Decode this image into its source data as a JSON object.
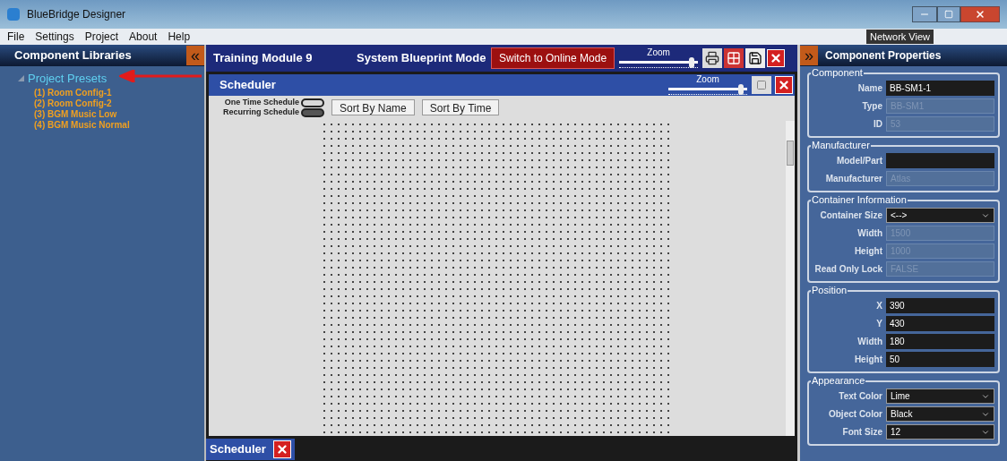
{
  "window": {
    "title": "BlueBridge Designer"
  },
  "menu": [
    "File",
    "Settings",
    "Project",
    "About",
    "Help"
  ],
  "network_view": "Network View",
  "left_panel": {
    "title": "Component Libraries",
    "collapse": "«",
    "tree": [
      {
        "label": "Project Presets",
        "expanded": true,
        "children": [
          {
            "label": "(1) Room Config-1"
          },
          {
            "label": "(2) Room Config-2"
          },
          {
            "label": "(3) BGM Music Low"
          },
          {
            "label": "(4) BGM Music Normal"
          }
        ]
      }
    ]
  },
  "workspace": {
    "title": "Training Module 9",
    "mode": "System Blueprint Mode",
    "online_button": "Switch to Online Mode",
    "zoom": {
      "label": "Zoom",
      "level": 0.95
    }
  },
  "scheduler": {
    "title": "Scheduler",
    "zoom": {
      "label": "Zoom",
      "level": 0.95
    },
    "legend": [
      {
        "label": "One Time Schedule",
        "color": "#d9d9d9"
      },
      {
        "label": "Recurring Schedule",
        "color": "#555555"
      }
    ],
    "buttons": [
      "Sort By Name",
      "Sort By Time"
    ]
  },
  "bottom_tabs": [
    {
      "label": "Scheduler",
      "selected": true
    }
  ],
  "right_panel": {
    "title": "Component Properties",
    "expand": "»",
    "groups": [
      {
        "title": "Component",
        "fields": [
          {
            "label": "Name",
            "value": "BB-SM1-1",
            "kind": "text",
            "disabled": false
          },
          {
            "label": "Type",
            "value": "BB-SM1",
            "kind": "text",
            "disabled": true
          },
          {
            "label": "ID",
            "value": "53",
            "kind": "text",
            "disabled": true
          }
        ]
      },
      {
        "title": "Manufacturer",
        "fields": [
          {
            "label": "Model/Part",
            "kind": "text",
            "disabled": false
          },
          {
            "label": "Manufacturer",
            "value": "Atlas",
            "kind": "text",
            "disabled": true
          }
        ]
      },
      {
        "title": "Container Information",
        "fields": [
          {
            "label": "Container Size",
            "value": "<-->",
            "kind": "select",
            "disabled": false
          },
          {
            "label": "Width",
            "value": "1500",
            "kind": "text",
            "disabled": true
          },
          {
            "label": "Height",
            "value": "1000",
            "kind": "text",
            "disabled": true
          },
          {
            "label": "Read Only Lock",
            "value": "FALSE",
            "kind": "text",
            "disabled": true
          }
        ]
      },
      {
        "title": "Position",
        "fields": [
          {
            "label": "X",
            "value": "390",
            "kind": "text",
            "disabled": false
          },
          {
            "label": "Y",
            "value": "430",
            "kind": "text",
            "disabled": false
          },
          {
            "label": "Width",
            "value": "180",
            "kind": "text",
            "disabled": false
          },
          {
            "label": "Height",
            "value": "50",
            "kind": "text",
            "disabled": false
          }
        ]
      },
      {
        "title": "Appearance",
        "fields": [
          {
            "label": "Text Color",
            "value": "Lime",
            "kind": "select",
            "disabled": false
          },
          {
            "label": "Object Color",
            "value": "Black",
            "kind": "select",
            "disabled": false
          },
          {
            "label": "Font Size",
            "value": "12",
            "kind": "select",
            "disabled": false
          }
        ]
      }
    ]
  }
}
